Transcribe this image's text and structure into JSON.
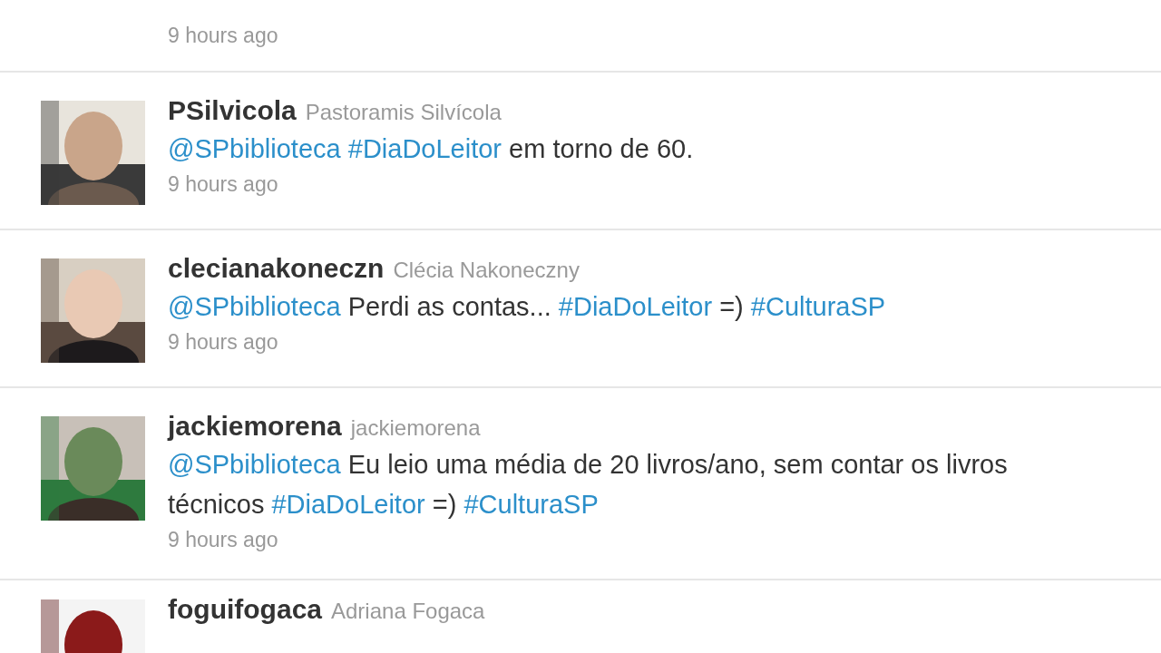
{
  "tweets": [
    {
      "kind": "partial",
      "time": "9 hours ago"
    },
    {
      "kind": "full",
      "username": "PSilvicola",
      "full_name": "Pastoramis Silvícola",
      "text": [
        {
          "kind": "link",
          "text": "@SPbiblioteca"
        },
        {
          "kind": "link",
          "text": "#DiaDoLeitor"
        },
        {
          "kind": "plain",
          "text": " em torno de 60."
        }
      ],
      "time": "9 hours ago"
    },
    {
      "kind": "full",
      "username": "clecianakoneczn",
      "full_name": "Clécia Nakoneczny",
      "text": [
        {
          "kind": "link",
          "text": "@SPbiblioteca"
        },
        {
          "kind": "plain",
          "text": " Perdi as contas... "
        },
        {
          "kind": "link",
          "text": "#DiaDoLeitor"
        },
        {
          "kind": "plain",
          "text": " =) "
        },
        {
          "kind": "link",
          "text": "#CulturaSP"
        }
      ],
      "time": "9 hours ago"
    },
    {
      "kind": "full",
      "username": "jackiemorena",
      "full_name": "jackiemorena",
      "text": [
        {
          "kind": "link",
          "text": "@SPbiblioteca"
        },
        {
          "kind": "plain",
          "text": " Eu leio uma média de 20 livros/ano, sem contar os livros técnicos "
        },
        {
          "kind": "link",
          "text": "#DiaDoLeitor"
        },
        {
          "kind": "plain",
          "text": " =) "
        },
        {
          "kind": "link",
          "text": "#CulturaSP"
        }
      ],
      "time": "9 hours ago"
    },
    {
      "kind": "full",
      "username": "foguifogaca",
      "full_name": "Adriana Fogaca"
    }
  ]
}
